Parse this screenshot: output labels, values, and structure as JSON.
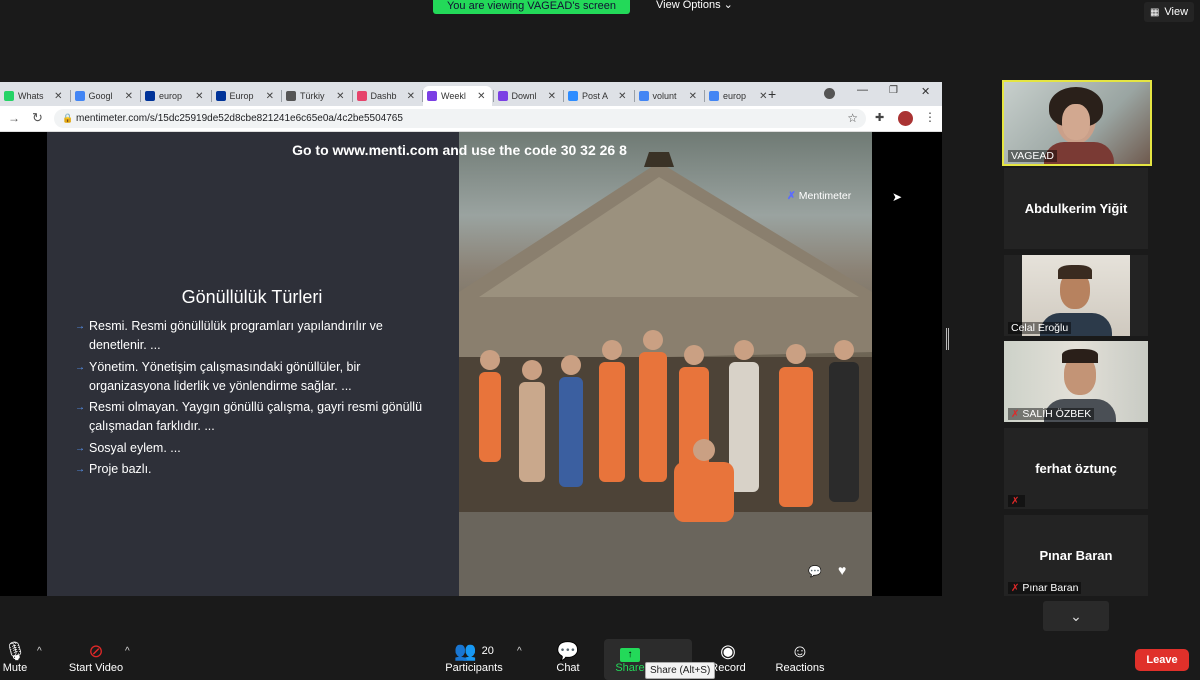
{
  "banner": {
    "sharing_text": "You are viewing VAGEAD's screen",
    "view_options": "View Options"
  },
  "view_button": {
    "label": "View"
  },
  "browser": {
    "tabs": [
      {
        "label": "Whats",
        "color": "#25d366"
      },
      {
        "label": "Googl",
        "color": "#4285f4"
      },
      {
        "label": "europ",
        "color": "#003399"
      },
      {
        "label": "Europ",
        "color": "#003399"
      },
      {
        "label": "Türkiy",
        "color": "#555555"
      },
      {
        "label": "Dashb",
        "color": "#e6436b"
      },
      {
        "label": "Weekl",
        "color": "#7b3fe4"
      },
      {
        "label": "Downl",
        "color": "#7b3fe4"
      },
      {
        "label": "Post A",
        "color": "#2d8cff"
      },
      {
        "label": "volunt",
        "color": "#4285f4"
      },
      {
        "label": "europ",
        "color": "#4285f4"
      }
    ],
    "url": "mentimeter.com/s/15dc25919de52d8cbe821241e6c65e0a/4c2be5504765"
  },
  "slide": {
    "code_line": "Go to www.menti.com and use the code 30 32 26 8",
    "logo": "Mentimeter",
    "title": "Gönüllülük Türleri",
    "bullets": [
      "Resmi. Resmi gönüllülük programları yapılandırılır ve denetlenir. ...",
      "Yönetim. Yönetişim çalışmasındaki gönüllüler, bir organizasyona liderlik ve yönlendirme sağlar. ...",
      "Resmi olmayan. Yaygın gönüllü çalışma, gayri resmi gönüllü çalışmadan farklıdır. ...",
      "Sosyal eylem. ...",
      "Proje bazlı."
    ]
  },
  "participants": [
    {
      "name": "VAGEAD",
      "video": true,
      "muted": false,
      "active": true
    },
    {
      "name": "Abdulkerim Yiğit",
      "video": false,
      "muted": false
    },
    {
      "name": "Celal Eroğlu",
      "video": true,
      "muted": false
    },
    {
      "name": "SALİH ÖZBEK",
      "video": true,
      "muted": true
    },
    {
      "name": "ferhat öztunç",
      "video": false,
      "muted": true
    },
    {
      "name": "Pınar Baran",
      "video": false,
      "muted": true
    }
  ],
  "toolbar": {
    "mute": "Mute",
    "start_video": "Start Video",
    "participants": "Participants",
    "participants_count": "20",
    "chat": "Chat",
    "share": "Share",
    "share_tooltip": "Share (Alt+S)",
    "record": "Record",
    "reactions": "Reactions",
    "leave": "Leave"
  },
  "colors": {
    "accent_green": "#23d959",
    "leave_red": "#e0302a",
    "active_border": "#e5e542"
  }
}
